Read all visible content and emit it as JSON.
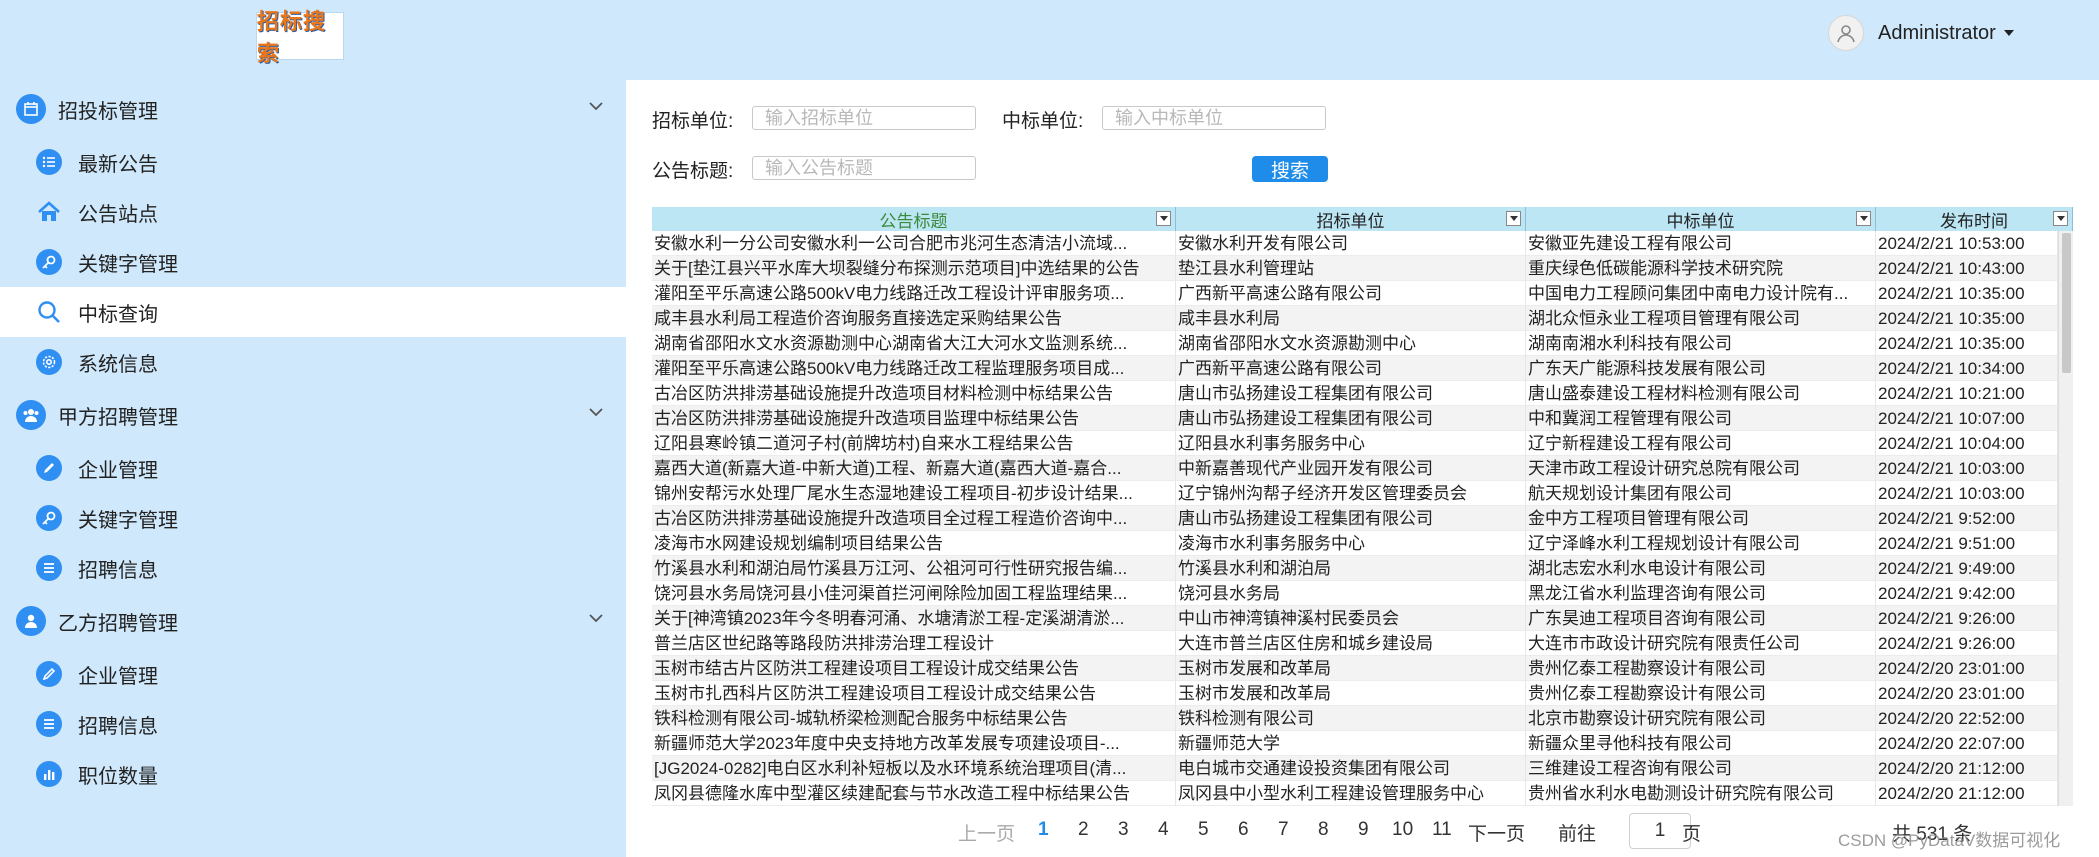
{
  "header": {
    "logo_text": "招标搜索",
    "user_name": "Administrator"
  },
  "sidebar": {
    "groups": [
      {
        "label": "招投标管理",
        "icon": "calendar-icon",
        "items": [
          {
            "label": "最新公告",
            "icon": "list-icon"
          },
          {
            "label": "公告站点",
            "icon": "home-icon"
          },
          {
            "label": "关键字管理",
            "icon": "key-icon"
          },
          {
            "label": "中标查询",
            "icon": "search-icon",
            "active": true
          },
          {
            "label": "系统信息",
            "icon": "gear-icon"
          }
        ]
      },
      {
        "label": "甲方招聘管理",
        "icon": "users-icon",
        "items": [
          {
            "label": "企业管理",
            "icon": "edit-icon"
          },
          {
            "label": "关键字管理",
            "icon": "key-icon"
          },
          {
            "label": "招聘信息",
            "icon": "list-icon"
          }
        ]
      },
      {
        "label": "乙方招聘管理",
        "icon": "user-icon",
        "items": [
          {
            "label": "企业管理",
            "icon": "edit-icon"
          },
          {
            "label": "招聘信息",
            "icon": "list-icon"
          },
          {
            "label": "职位数量",
            "icon": "bar-chart-icon"
          }
        ]
      }
    ]
  },
  "filters": {
    "tender_unit_label": "招标单位:",
    "tender_unit_placeholder": "输入招标单位",
    "winner_unit_label": "中标单位:",
    "winner_unit_placeholder": "输入中标单位",
    "title_label": "公告标题:",
    "title_placeholder": "输入公告标题",
    "search_label": "搜索"
  },
  "table": {
    "columns": [
      "公告标题",
      "招标单位",
      "中标单位",
      "发布时间"
    ],
    "rows": [
      [
        "安徽水利一分公司安徽水利一公司合肥市兆河生态清洁小流域...",
        "安徽水利开发有限公司",
        "安徽亚先建设工程有限公司",
        "2024/2/21 10:53:00"
      ],
      [
        "关于[垫江县兴平水库大坝裂缝分布探测示范项目]中选结果的公告",
        "垫江县水利管理站",
        "重庆绿色低碳能源科学技术研究院",
        "2024/2/21 10:43:00"
      ],
      [
        "灌阳至平乐高速公路500kV电力线路迁改工程设计评审服务项...",
        "广西新平高速公路有限公司",
        "中国电力工程顾问集团中南电力设计院有...",
        "2024/2/21 10:35:00"
      ],
      [
        "咸丰县水利局工程造价咨询服务直接选定采购结果公告",
        "咸丰县水利局",
        "湖北众恒永业工程项目管理有限公司",
        "2024/2/21 10:35:00"
      ],
      [
        "湖南省邵阳水文水资源勘测中心湖南省大江大河水文监测系统...",
        "湖南省邵阳水文水资源勘测中心",
        "湖南南湘水利科技有限公司",
        "2024/2/21 10:35:00"
      ],
      [
        "灌阳至平乐高速公路500kV电力线路迁改工程监理服务项目成...",
        "广西新平高速公路有限公司",
        "广东天广能源科技发展有限公司",
        "2024/2/21 10:34:00"
      ],
      [
        "古冶区防洪排涝基础设施提升改造项目材料检测中标结果公告",
        "唐山市弘扬建设工程集团有限公司",
        "唐山盛泰建设工程材料检测有限公司",
        "2024/2/21 10:21:00"
      ],
      [
        "古冶区防洪排涝基础设施提升改造项目监理中标结果公告",
        "唐山市弘扬建设工程集团有限公司",
        "中和冀润工程管理有限公司",
        "2024/2/21 10:07:00"
      ],
      [
        "辽阳县寒岭镇二道河子村(前牌坊村)自来水工程结果公告",
        "辽阳县水利事务服务中心",
        "辽宁新程建设工程有限公司",
        "2024/2/21 10:04:00"
      ],
      [
        "嘉西大道(新嘉大道-中新大道)工程、新嘉大道(嘉西大道-嘉合...",
        "中新嘉善现代产业园开发有限公司",
        "天津市政工程设计研究总院有限公司",
        "2024/2/21 10:03:00"
      ],
      [
        "锦州安帮污水处理厂尾水生态湿地建设工程项目-初步设计结果...",
        "辽宁锦州沟帮子经济开发区管理委员会",
        "航天规划设计集团有限公司",
        "2024/2/21 10:03:00"
      ],
      [
        "古冶区防洪排涝基础设施提升改造项目全过程工程造价咨询中...",
        "唐山市弘扬建设工程集团有限公司",
        "金中方工程项目管理有限公司",
        "2024/2/21 9:52:00"
      ],
      [
        "凌海市水网建设规划编制项目结果公告",
        "凌海市水利事务服务中心",
        "辽宁泽峰水利工程规划设计有限公司",
        "2024/2/21 9:51:00"
      ],
      [
        "竹溪县水利和湖泊局竹溪县万江河、公祖河可行性研究报告编...",
        "竹溪县水利和湖泊局",
        "湖北志宏水利水电设计有限公司",
        "2024/2/21 9:49:00"
      ],
      [
        "饶河县水务局饶河县小佳河渠首拦河闸除险加固工程监理结果...",
        "饶河县水务局",
        "黑龙江省水利监理咨询有限公司",
        "2024/2/21 9:42:00"
      ],
      [
        "关于[神湾镇2023年今冬明春河涌、水塘清淤工程-定溪湖清淤...",
        "中山市神湾镇神溪村民委员会",
        "广东昊迪工程项目咨询有限公司",
        "2024/2/21 9:26:00"
      ],
      [
        "普兰店区世纪路等路段防洪排涝治理工程设计",
        "大连市普兰店区住房和城乡建设局",
        "大连市市政设计研究院有限责任公司",
        "2024/2/21 9:26:00"
      ],
      [
        "玉树市结古片区防洪工程建设项目工程设计成交结果公告",
        "玉树市发展和改革局",
        "贵州亿泰工程勘察设计有限公司",
        "2024/2/20 23:01:00"
      ],
      [
        "玉树市扎西科片区防洪工程建设项目工程设计成交结果公告",
        "玉树市发展和改革局",
        "贵州亿泰工程勘察设计有限公司",
        "2024/2/20 23:01:00"
      ],
      [
        "铁科检测有限公司-城轨桥梁检测配合服务中标结果公告",
        "铁科检测有限公司",
        "北京市勘察设计研究院有限公司",
        "2024/2/20 22:52:00"
      ],
      [
        "新疆师范大学2023年度中央支持地方改革发展专项建设项目-...",
        "新疆师范大学",
        "新疆众里寻他科技有限公司",
        "2024/2/20 22:07:00"
      ],
      [
        "[JG2024-0282]电白区水利补短板以及水环境系统治理项目(清...",
        "电白城市交通建设投资集团有限公司",
        "三维建设工程咨询有限公司",
        "2024/2/20 21:12:00"
      ],
      [
        "凤冈县德隆水库中型灌区续建配套与节水改造工程中标结果公告",
        "凤冈县中小型水利工程建设管理服务中心",
        "贵州省水利水电勘测设计研究院有限公司",
        "2024/2/20 21:12:00"
      ]
    ]
  },
  "pager": {
    "prev": "上一页",
    "pages": [
      "1",
      "2",
      "3",
      "4",
      "5",
      "6",
      "7",
      "8",
      "9",
      "10",
      "11"
    ],
    "current": "1",
    "next": "下一页",
    "goto_label": "前往",
    "goto_value": "1",
    "page_unit": "页",
    "total": "共 531 条"
  },
  "watermark": "CSDN @PyDataV数据可视化",
  "colors": {
    "sidebar_bg": "#cfe8fb",
    "accent": "#2f8ff3",
    "header_row": "#bde6f5",
    "search_button": "#1e8ce8"
  }
}
